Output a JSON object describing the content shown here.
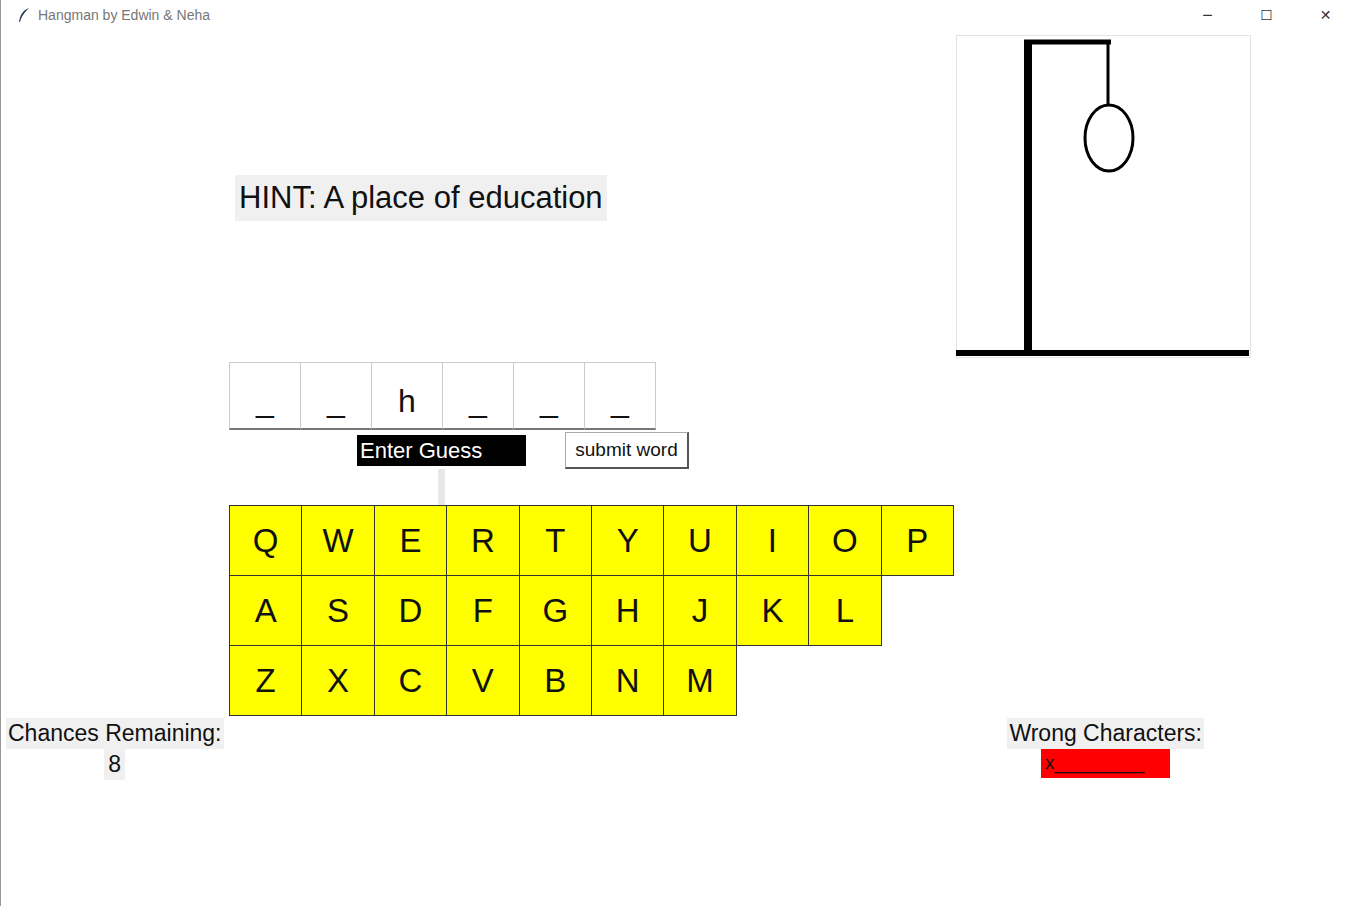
{
  "window": {
    "title": "Hangman by Edwin & Neha",
    "controls": [
      "─",
      "☐",
      "✕"
    ]
  },
  "hint": "HINT: A place of education",
  "word": [
    "_",
    "_",
    "h",
    "_",
    "_",
    "_"
  ],
  "guess_entry": {
    "value": "Enter Guess"
  },
  "submit_button": "submit word",
  "keyboard": [
    [
      "Q",
      "W",
      "E",
      "R",
      "T",
      "Y",
      "U",
      "I",
      "O",
      "P"
    ],
    [
      "A",
      "S",
      "D",
      "F",
      "G",
      "H",
      "J",
      "K",
      "L"
    ],
    [
      "Z",
      "X",
      "C",
      "V",
      "B",
      "N",
      "M"
    ]
  ],
  "chances": {
    "label": "Chances Remaining:",
    "value": "8"
  },
  "wrong": {
    "label": "Wrong Characters:",
    "value": "x_________"
  },
  "hangman": {
    "head": true,
    "body": false,
    "left_arm": false,
    "right_arm": false,
    "left_leg": false,
    "right_leg": false
  }
}
